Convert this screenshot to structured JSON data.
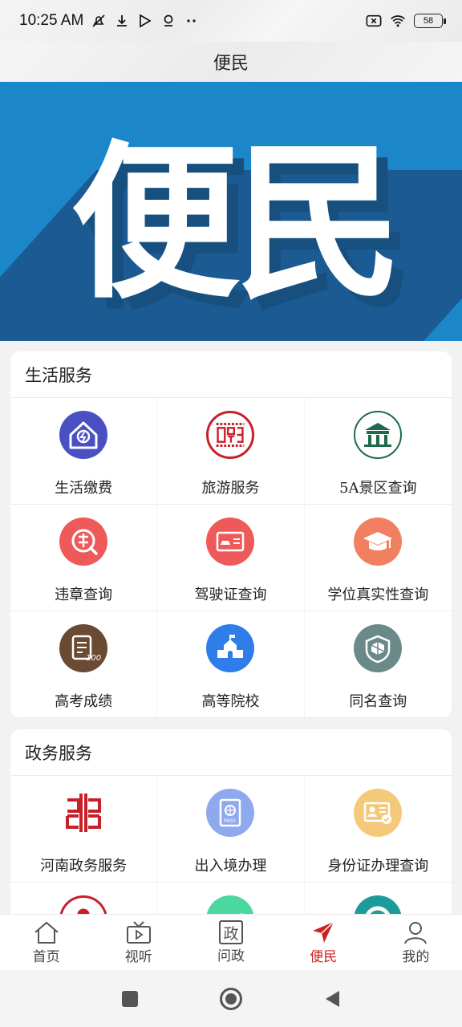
{
  "status": {
    "time": "10:25 AM",
    "battery": "58",
    "icons": [
      "mute-icon",
      "download-icon",
      "play-store-icon",
      "location-icon",
      "more-dots-icon",
      "no-sim-icon",
      "wifi-icon",
      "battery-icon"
    ]
  },
  "header": {
    "title": "便民"
  },
  "banner": {
    "text": "便民",
    "colors": {
      "bg": "#1b87c9",
      "shadow": "#1b5a92"
    }
  },
  "life_services": {
    "title": "生活服务",
    "items": [
      {
        "label": "生活缴费",
        "icon": "house-bill-icon",
        "color": "#4a4fc4"
      },
      {
        "label": "旅游服务",
        "icon": "travel-seal-icon",
        "color": "#c8202a"
      },
      {
        "label": "5A景区查询",
        "icon": "scenic-gate-icon",
        "color": "#1d6b4a"
      },
      {
        "label": "违章查询",
        "icon": "violation-search-icon",
        "color": "#ee5a5a"
      },
      {
        "label": "驾驶证查询",
        "icon": "driver-license-icon",
        "color": "#ee5a5a"
      },
      {
        "label": "学位真实性查询",
        "icon": "graduation-cap-icon",
        "color": "#f08060"
      },
      {
        "label": "高考成绩",
        "icon": "exam-score-icon",
        "color": "#6b4a34"
      },
      {
        "label": "高等院校",
        "icon": "university-icon",
        "color": "#2f7de8"
      },
      {
        "label": "同名查询",
        "icon": "shield-cube-icon",
        "color": "#6a8a8a"
      }
    ]
  },
  "gov_services": {
    "title": "政务服务",
    "items": [
      {
        "label": "河南政务服务",
        "icon": "henan-gov-logo-icon",
        "color": "#c8202a"
      },
      {
        "label": "出入境办理",
        "icon": "passport-icon",
        "color": "#8fa9ee"
      },
      {
        "label": "身份证办理查询",
        "icon": "id-card-icon",
        "color": "#f5c97a"
      }
    ]
  },
  "tabs": [
    {
      "label": "首页",
      "icon": "home-icon"
    },
    {
      "label": "视听",
      "icon": "tv-icon"
    },
    {
      "label": "问政",
      "icon": "gov-ask-icon",
      "glyph": "政"
    },
    {
      "label": "便民",
      "icon": "send-arrow-icon",
      "active": true
    },
    {
      "label": "我的",
      "icon": "user-icon"
    }
  ],
  "accent": "#cc2222"
}
